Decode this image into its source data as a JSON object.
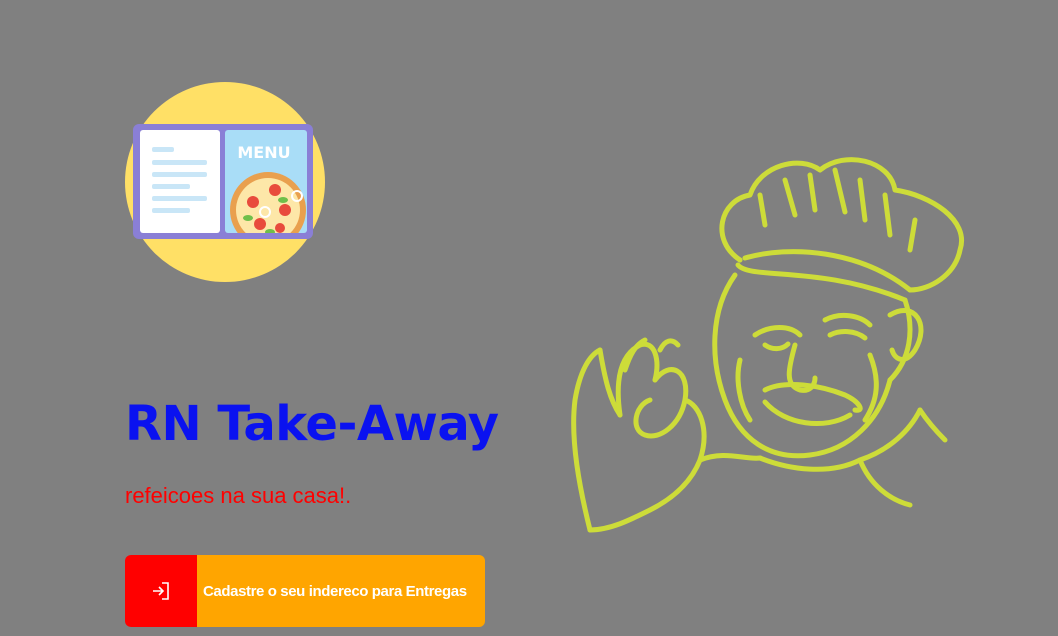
{
  "hero": {
    "title": "RN Take-Away",
    "subtitle": "refeicoes na sua casa!."
  },
  "logo": {
    "icon": "menu-book-icon",
    "menu_text": "MENU",
    "circle_color": "#ffe066"
  },
  "cta": {
    "label": "Cadastre o seu indereco para Entregas",
    "icon": "sign-in-icon",
    "icon_bg": "#ff0000",
    "label_bg": "#ffa500"
  },
  "illustration": {
    "icon": "chef-icon",
    "stroke_color": "#cddc39"
  },
  "colors": {
    "background": "#808080",
    "title": "#0a12f0",
    "subtitle": "#ff0000"
  }
}
